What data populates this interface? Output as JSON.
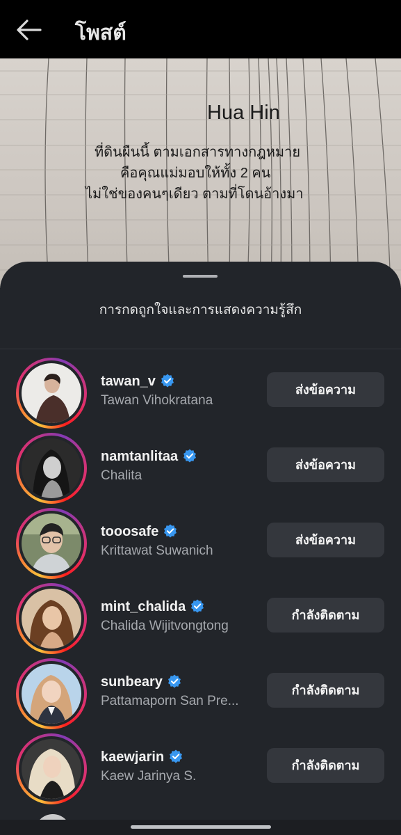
{
  "header": {
    "title": "โพสต์",
    "back_icon": "arrow-left-icon"
  },
  "photo": {
    "heading": "Hua Hin",
    "lines": [
      "ที่ดินผืนนี้ ตามเอกสารทางกฎหมาย",
      "คือคุณแม่มอบให้ทั้ง 2 คน",
      "ไม่ใช่ของคนๆเดียว ตามที่โดนอ้างมา"
    ]
  },
  "sheet": {
    "title": "การกดถูกใจและการแสดงความรู้สึก",
    "users": [
      {
        "username": "tawan_v",
        "full_name": "Tawan Vihokratana",
        "button": "ส่งข้อความ",
        "verified": true
      },
      {
        "username": "namtanlitaa",
        "full_name": "Chalita",
        "button": "ส่งข้อความ",
        "verified": true
      },
      {
        "username": "tooosafe",
        "full_name": "Krittawat Suwanich",
        "button": "ส่งข้อความ",
        "verified": true
      },
      {
        "username": "mint_chalida",
        "full_name": "Chalida Wijitvongtong",
        "button": "กำลังติดตาม",
        "verified": true
      },
      {
        "username": "sunbeary",
        "full_name": "Pattamaporn San Pre...",
        "button": "กำลังติดตาม",
        "verified": true
      },
      {
        "username": "kaewjarin",
        "full_name": "Kaew Jarinya S.",
        "button": "กำลังติดตาม",
        "verified": true
      }
    ]
  },
  "colors": {
    "sheet_bg": "#22252a",
    "button_bg": "#34373d",
    "verified_blue": "#3897f0"
  }
}
